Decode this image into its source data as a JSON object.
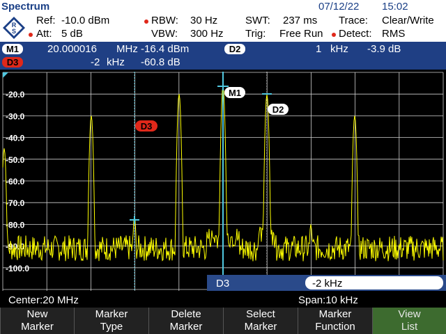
{
  "title_bar": {
    "app_title": "Spectrum",
    "date": "07/12/22",
    "time": "15:02"
  },
  "settings": {
    "ref_label": "Ref:",
    "ref_value": "-10.0 dBm",
    "att_label": "Att:",
    "att_value": "5 dB",
    "rbw_label": "RBW:",
    "rbw_value": "30 Hz",
    "vbw_label": "VBW:",
    "vbw_value": "300 Hz",
    "swt_label": "SWT:",
    "swt_value": "237 ms",
    "trig_label": "Trig:",
    "trig_value": "Free Run",
    "trace_label": "Trace:",
    "trace_value": "Clear/Write",
    "detect_label": "Detect:",
    "detect_value": "RMS"
  },
  "marker_info": {
    "m1": {
      "tag": "M1",
      "freq": "20.000016",
      "freq_unit": "MHz",
      "level": "-16.4 dBm"
    },
    "d2": {
      "tag": "D2",
      "freq": "1",
      "freq_unit": "kHz",
      "level": "-3.9 dB"
    },
    "d3": {
      "tag": "D3",
      "freq": "-2",
      "freq_unit": "kHz",
      "level": "-60.8 dB"
    }
  },
  "plot": {
    "y_tick_labels": [
      "-20.0",
      "-30.0",
      "-40.0",
      "-50.0",
      "-60.0",
      "-70.0",
      "-80.0",
      "-90.0",
      "-100.0"
    ],
    "marker_labels": {
      "m1": "M1",
      "d2": "D2",
      "d3": "D3"
    },
    "input_label": "D3",
    "input_value": "-2 kHz",
    "colors": {
      "trace": "#ffff00",
      "grid": "#d0d0d0",
      "marker_line": "#50c8e0"
    }
  },
  "center_bar": {
    "center": "Center:20 MHz",
    "span": "Span:10 kHz"
  },
  "softkeys": [
    {
      "line1": "New",
      "line2": "Marker"
    },
    {
      "line1": "Marker",
      "line2": "Type"
    },
    {
      "line1": "Delete",
      "line2": "Marker"
    },
    {
      "line1": "Select",
      "line2": "Marker"
    },
    {
      "line1": "Marker",
      "line2": "Function"
    },
    {
      "line1": "View",
      "line2": "List"
    }
  ]
}
